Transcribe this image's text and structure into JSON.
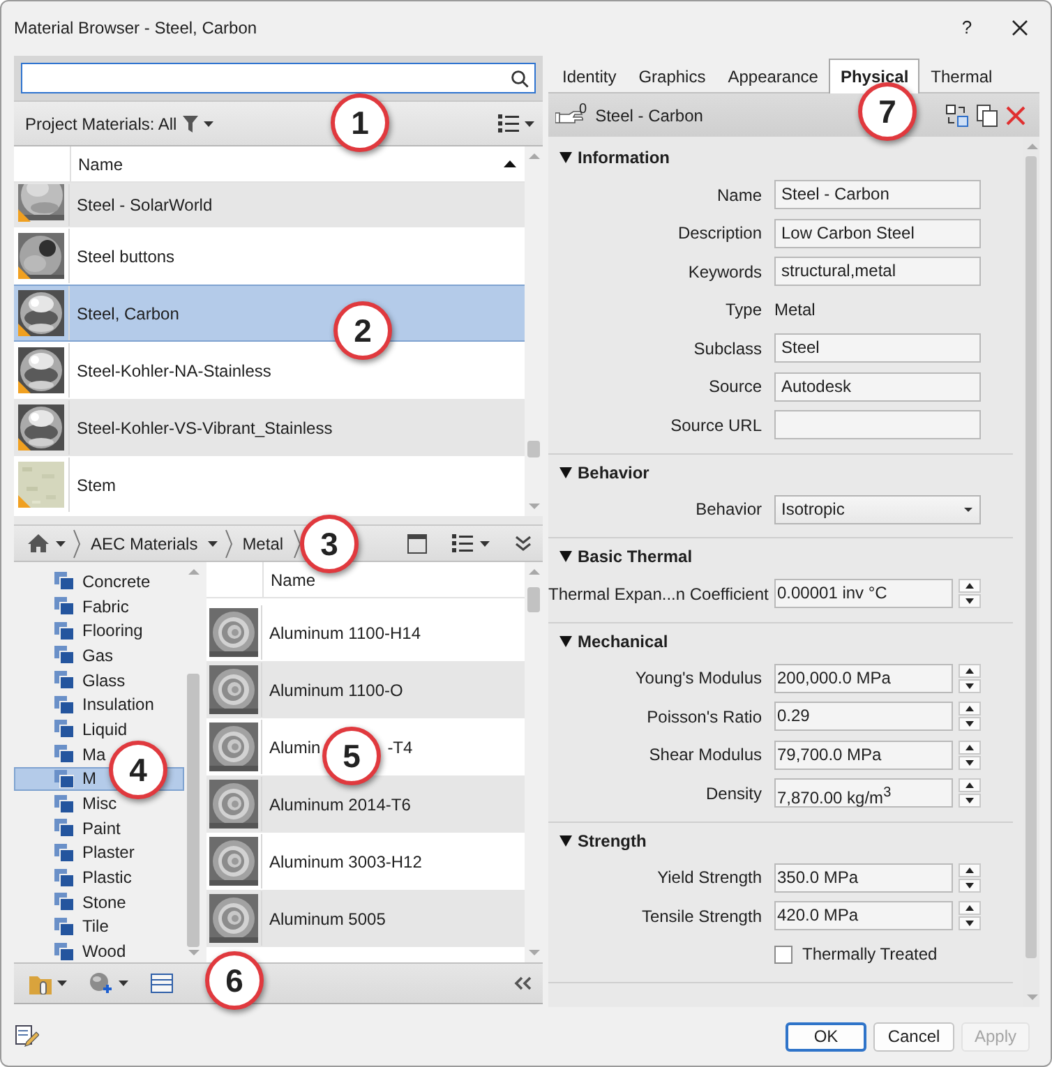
{
  "window": {
    "title": "Material Browser - Steel, Carbon",
    "help": "?"
  },
  "project_filter": {
    "label": "Project Materials: All"
  },
  "project_list": {
    "column": "Name",
    "rows": [
      {
        "name": "Steel - SolarWorld",
        "selected": false,
        "warning": true
      },
      {
        "name": "Steel buttons",
        "selected": false,
        "warning": true
      },
      {
        "name": "Steel, Carbon",
        "selected": true,
        "warning": true
      },
      {
        "name": "Steel-Kohler-NA-Stainless",
        "selected": false,
        "warning": true
      },
      {
        "name": "Steel-Kohler-VS-Vibrant_Stainless",
        "selected": false,
        "warning": true
      },
      {
        "name": "Stem",
        "selected": false,
        "warning": true
      }
    ]
  },
  "breadcrumb": [
    {
      "label": "AEC Materials"
    },
    {
      "label": "Metal"
    }
  ],
  "categories": [
    {
      "label": "Concrete",
      "selected": false
    },
    {
      "label": "Fabric",
      "selected": false
    },
    {
      "label": "Flooring",
      "selected": false
    },
    {
      "label": "Gas",
      "selected": false
    },
    {
      "label": "Glass",
      "selected": false
    },
    {
      "label": "Insulation",
      "selected": false
    },
    {
      "label": "Liquid",
      "selected": false
    },
    {
      "label": "Ma",
      "selected": false
    },
    {
      "label": "M",
      "selected": true
    },
    {
      "label": "Misc",
      "selected": false
    },
    {
      "label": "Paint",
      "selected": false
    },
    {
      "label": "Plaster",
      "selected": false
    },
    {
      "label": "Plastic",
      "selected": false
    },
    {
      "label": "Stone",
      "selected": false
    },
    {
      "label": "Tile",
      "selected": false
    },
    {
      "label": "Wood",
      "selected": false
    }
  ],
  "library_list": {
    "column": "Name",
    "rows": [
      {
        "name": "Aluminum 1100-H14",
        "selected": false
      },
      {
        "name": "Aluminum 1100-O",
        "selected": false
      },
      {
        "name": "Alumin",
        "tail": "-T4",
        "selected": false
      },
      {
        "name": "Aluminum 2014-T6",
        "selected": false
      },
      {
        "name": "Aluminum 3003-H12",
        "selected": false
      },
      {
        "name": "Aluminum 5005",
        "selected": false
      }
    ]
  },
  "tabs": [
    {
      "label": "Identity",
      "selected": false
    },
    {
      "label": "Graphics",
      "selected": false
    },
    {
      "label": "Appearance",
      "selected": false
    },
    {
      "label": "Physical",
      "selected": true
    },
    {
      "label": "Thermal",
      "selected": false
    }
  ],
  "asset": {
    "users": "0",
    "name": "Steel - Carbon"
  },
  "sections": [
    {
      "title": "Information",
      "expanded": true,
      "rows": [
        {
          "kind": "field",
          "label": "Name",
          "value": "Steel - Carbon"
        },
        {
          "kind": "field",
          "label": "Description",
          "value": "Low Carbon Steel"
        },
        {
          "kind": "field",
          "label": "Keywords",
          "value": "structural,metal"
        },
        {
          "kind": "static",
          "label": "Type",
          "value": "Metal"
        },
        {
          "kind": "field",
          "label": "Subclass",
          "value": "Steel"
        },
        {
          "kind": "field",
          "label": "Source",
          "value": "Autodesk"
        },
        {
          "kind": "field",
          "label": "Source URL"
        }
      ]
    },
    {
      "title": "Behavior",
      "expanded": true,
      "rows": [
        {
          "kind": "select",
          "label": "Behavior",
          "value": "Isotropic"
        }
      ]
    },
    {
      "title": "Basic Thermal",
      "expanded": true,
      "rows": [
        {
          "kind": "spinner",
          "label": "Thermal Expan...n Coefficient",
          "value": "0.00001 inv °C"
        }
      ]
    },
    {
      "title": "Mechanical",
      "expanded": true,
      "rows": [
        {
          "kind": "spinner",
          "label": "Young's Modulus",
          "value": "200,000.0 MPa"
        },
        {
          "kind": "spinner",
          "label": "Poisson's Ratio",
          "value": "0.29"
        },
        {
          "kind": "spinner",
          "label": "Shear Modulus",
          "value": "79,700.0 MPa"
        },
        {
          "kind": "spinner",
          "label": "Density",
          "value": "7,870.00 kg/m$^{3}$"
        }
      ]
    },
    {
      "title": "Strength",
      "expanded": true,
      "rows": [
        {
          "kind": "spinner",
          "label": "Yield Strength",
          "value": "350.0 MPa"
        },
        {
          "kind": "spinner",
          "label": "Tensile Strength",
          "value": "420.0 MPa"
        },
        {
          "kind": "checkbox",
          "label": "Thermally Treated",
          "checked": false
        }
      ]
    }
  ],
  "buttons": [
    {
      "label": "OK",
      "default": true,
      "disabled": false
    },
    {
      "label": "Cancel",
      "default": false,
      "disabled": false
    },
    {
      "label": "Apply",
      "default": false,
      "disabled": true
    }
  ],
  "callouts": [
    {
      "number": "1"
    },
    {
      "number": "2"
    },
    {
      "number": "3"
    },
    {
      "number": "4"
    },
    {
      "number": "5"
    },
    {
      "number": "6"
    },
    {
      "number": "7"
    }
  ]
}
